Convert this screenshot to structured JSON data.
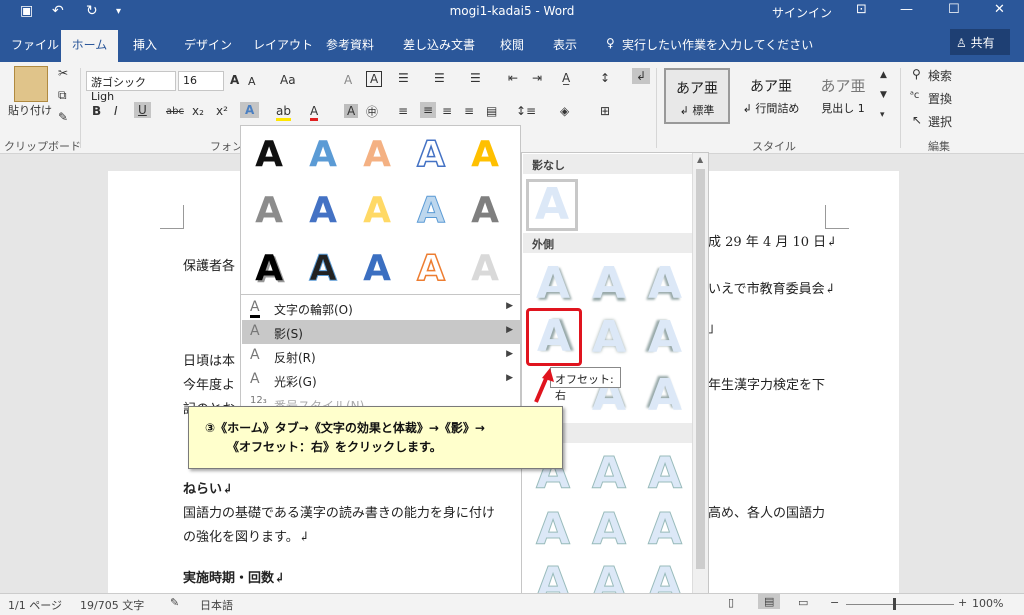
{
  "titlebar": {
    "title": "mogi1-kadai5  -  Word",
    "signin": "サインイン",
    "share": "共有"
  },
  "tabs": {
    "file": "ファイル",
    "home": "ホーム",
    "insert": "挿入",
    "design": "デザイン",
    "layout": "レイアウト",
    "references": "参考資料",
    "mailings": "差し込み文書",
    "review": "校閲",
    "view": "表示",
    "tellme": "実行したい作業を入力してください"
  },
  "ribbon": {
    "paste": "貼り付け",
    "clipboard_label": "クリップボード",
    "font_label": "フォント",
    "font_name": "游ゴシック Ligh",
    "font_size": "16",
    "styles_label": "スタイル",
    "edit_label": "編集",
    "style_1_sample": "あア亜",
    "style_1_name": "↲ 標準",
    "style_2_sample": "あア亜",
    "style_2_name": "↲ 行間詰め",
    "style_3_sample": "あア亜",
    "style_3_name": "見出し 1",
    "find": "検索",
    "replace": "置換",
    "select": "選択"
  },
  "document": {
    "line_date": "成 29 年 4 月 10 日↲",
    "line_greeting": "保護者各",
    "line_board": "いえで市教育委員会↲",
    "line_greet2": "日頃は本",
    "line_year": "今年度よ",
    "line_kentei": "年生漢字力検定を下",
    "line_next": "記のとお",
    "heading_aim": "ねらい↲",
    "aim_1": "国語力の基礎である漢字の読み書きの能力を身に付け",
    "aim_1_end": "高め、各人の国語力",
    "aim_2": "の強化を図ります。↲",
    "heading_date": "実施時期・回数↲"
  },
  "gallery": {
    "menu_outline": "文字の輪郭(O)",
    "menu_shadow": "影(S)",
    "menu_reflection": "反射(R)",
    "menu_glow": "光彩(G)",
    "menu_number": "番号スタイル(N)"
  },
  "shadow_menu": {
    "none_heading": "影なし",
    "outer_heading": "外側",
    "tooltip": "オフセット: 右"
  },
  "callout": {
    "line1": "③《ホーム》タブ→《文字の効果と体裁》→《影》→",
    "line2": "《オフセット：右》をクリックします。"
  },
  "status": {
    "page": "1/1 ページ",
    "words": "19/705 文字",
    "lang": "日本語",
    "zoom": "100%"
  }
}
